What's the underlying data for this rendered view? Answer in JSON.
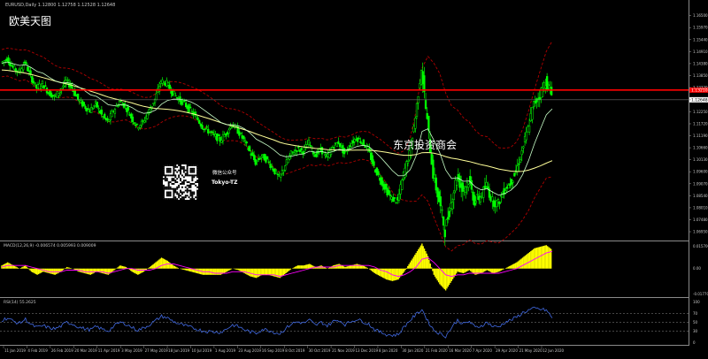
{
  "window": {
    "header": "EURUSD,Daily  1.12800 1.12758 1.12528 1.12648",
    "watermark_main": "欧美天图",
    "watermark_center": "东京投资商会",
    "promo_line1": "微信公众号",
    "promo_line2": "Tokyo-TZ"
  },
  "macd": {
    "header": "MACD(12,26,9) -0.006574 0.005993 0.009009",
    "y_ticks": [
      "0.015700",
      "0.00",
      "-0.017700"
    ]
  },
  "rsi": {
    "header": "RSI(14) 55.2625",
    "y_ticks": [
      "100",
      "70",
      "50",
      "30",
      "0"
    ]
  },
  "x_ticks": [
    "11 Jan 2019",
    "4 Feb 2019",
    "26 Feb 2019",
    "20 Mar 2019",
    "11 Apr 2019",
    "3 May 2019",
    "27 May 2019",
    "18 Jun 2019",
    "10 Jul 2019",
    "1 Aug 2019",
    "23 Aug 2019",
    "16 Sep 2019",
    "8 Oct 2019",
    "30 Oct 2019",
    "21 Nov 2019",
    "13 Dec 2019",
    "8 Jan 2020",
    "30 Jan 2020",
    "21 Feb 2020",
    "16 Mar 2020",
    "7 Apr 2020",
    "29 Apr 2020",
    "21 May 2020",
    "12 Jun 2020"
  ],
  "colors": {
    "candle": "#00ff00",
    "ma_slow": "#ffff99",
    "ma_fast": "#c8ffc8",
    "band": "#b00000",
    "hline": "#ff0000",
    "macd_hist": "#ffff00",
    "macd_signal": "#ff00ff",
    "rsi_line": "#4169e1"
  },
  "chart_data": {
    "type": "line",
    "symbol": "EURUSD",
    "timeframe": "Daily",
    "y_ticks": [
      "1.16500",
      "1.15970",
      "1.15440",
      "1.14910",
      "1.14380",
      "1.13850",
      "1.13320",
      "1.12780",
      "1.12250",
      "1.11720",
      "1.11190",
      "1.10660",
      "1.10130",
      "1.09600",
      "1.09070",
      "1.08540",
      "1.08010",
      "1.07480",
      "1.06950"
    ],
    "ylim": [
      1.066,
      1.168
    ],
    "price_label": "1.12648",
    "hline_label": "1.13210",
    "hline_value": 1.1321,
    "price": [
      1.144,
      1.146,
      1.142,
      1.14,
      1.1445,
      1.138,
      1.133,
      1.135,
      1.131,
      1.129,
      1.132,
      1.136,
      1.133,
      1.128,
      1.125,
      1.123,
      1.126,
      1.121,
      1.118,
      1.123,
      1.127,
      1.125,
      1.12,
      1.116,
      1.118,
      1.123,
      1.128,
      1.136,
      1.135,
      1.131,
      1.128,
      1.126,
      1.123,
      1.12,
      1.116,
      1.114,
      1.112,
      1.11,
      1.113,
      1.117,
      1.114,
      1.11,
      1.105,
      1.1,
      1.103,
      1.101,
      1.097,
      1.093,
      1.099,
      1.104,
      1.106,
      1.105,
      1.109,
      1.103,
      1.106,
      1.102,
      1.107,
      1.109,
      1.104,
      1.108,
      1.111,
      1.109,
      1.106,
      1.098,
      1.093,
      1.088,
      1.084,
      1.083,
      1.095,
      1.104,
      1.12,
      1.142,
      1.118,
      1.095,
      1.083,
      1.07,
      1.082,
      1.094,
      1.088,
      1.092,
      1.083,
      1.085,
      1.09,
      1.083,
      1.082,
      1.088,
      1.091,
      1.096,
      1.105,
      1.115,
      1.126,
      1.13,
      1.136,
      1.13
    ],
    "ma_slow": [
      1.141,
      1.1408,
      1.1404,
      1.14,
      1.1396,
      1.139,
      1.1383,
      1.1376,
      1.1369,
      1.1361,
      1.1354,
      1.1348,
      1.1341,
      1.1333,
      1.1325,
      1.1316,
      1.1308,
      1.1299,
      1.129,
      1.1283,
      1.1277,
      1.1271,
      1.1264,
      1.1256,
      1.1249,
      1.1244,
      1.124,
      1.1238,
      1.1236,
      1.1233,
      1.1229,
      1.1224,
      1.1218,
      1.1211,
      1.1203,
      1.1195,
      1.1186,
      1.1177,
      1.1169,
      1.1162,
      1.1154,
      1.1146,
      1.1137,
      1.1127,
      1.1118,
      1.1109,
      1.11,
      1.109,
      1.1083,
      1.1078,
      1.1074,
      1.107,
      1.1067,
      1.1063,
      1.1061,
      1.1058,
      1.1057,
      1.1056,
      1.1055,
      1.1055,
      1.1056,
      1.1056,
      1.1055,
      1.1053,
      1.105,
      1.1046,
      1.1041,
      1.1036,
      1.1033,
      1.1033,
      1.1036,
      1.1044,
      1.1045,
      1.1042,
      1.1036,
      1.1027,
      1.102,
      1.1016,
      1.101,
      1.1005,
      1.0998,
      1.0991,
      1.0986,
      1.0979,
      1.0972,
      1.0967,
      1.0963,
      1.0961,
      1.0962,
      1.0967,
      1.0976,
      1.0986,
      1.0998,
      1.1009
    ],
    "ma_fast": [
      1.144,
      1.1445,
      1.1437,
      1.143,
      1.1433,
      1.142,
      1.1403,
      1.1395,
      1.1378,
      1.1362,
      1.1353,
      1.1354,
      1.1349,
      1.1335,
      1.1318,
      1.13,
      1.1293,
      1.1276,
      1.1256,
      1.1252,
      1.1256,
      1.1255,
      1.1244,
      1.1227,
      1.1218,
      1.1221,
      1.1233,
      1.1259,
      1.1275,
      1.1281,
      1.1281,
      1.1277,
      1.1268,
      1.1255,
      1.1236,
      1.1217,
      1.1198,
      1.1178,
      1.1168,
      1.1168,
      1.1163,
      1.115,
      1.113,
      1.1104,
      1.109,
      1.1075,
      1.1056,
      1.1034,
      1.1026,
      1.1029,
      1.1035,
      1.1039,
      1.1051,
      1.1046,
      1.105,
      1.1043,
      1.105,
      1.1059,
      1.1055,
      1.1061,
      1.1072,
      1.1077,
      1.1072,
      1.1049,
      1.1024,
      1.0995,
      1.0965,
      1.0942,
      1.0943,
      1.0969,
      1.103,
      1.1138,
      1.115,
      1.11,
      1.1044,
      1.0968,
      1.093,
      1.0933,
      1.0918,
      1.0919,
      1.0893,
      1.088,
      1.0885,
      1.0869,
      1.0856,
      1.0864,
      1.0878,
      1.0903,
      1.0948,
      1.1009,
      1.1084,
      1.1149,
      1.1212,
      1.1238
    ],
    "band_width": [
      0.006,
      0.0062,
      0.0065,
      0.0068,
      0.0066,
      0.007,
      0.0074,
      0.0072,
      0.007,
      0.0068,
      0.0066,
      0.0064,
      0.0063,
      0.0066,
      0.007,
      0.0072,
      0.007,
      0.0072,
      0.0075,
      0.0072,
      0.007,
      0.0066,
      0.0068,
      0.0072,
      0.007,
      0.0068,
      0.0072,
      0.008,
      0.0082,
      0.0078,
      0.0074,
      0.007,
      0.0068,
      0.007,
      0.0074,
      0.0076,
      0.0076,
      0.0075,
      0.0072,
      0.007,
      0.0068,
      0.007,
      0.0074,
      0.0078,
      0.0076,
      0.0074,
      0.0076,
      0.008,
      0.0076,
      0.007,
      0.0066,
      0.0062,
      0.006,
      0.006,
      0.0058,
      0.0058,
      0.0058,
      0.0058,
      0.0058,
      0.006,
      0.0062,
      0.0062,
      0.0064,
      0.007,
      0.0078,
      0.0086,
      0.0094,
      0.01,
      0.011,
      0.014,
      0.02,
      0.028,
      0.032,
      0.034,
      0.035,
      0.034,
      0.032,
      0.03,
      0.028,
      0.026,
      0.025,
      0.024,
      0.023,
      0.022,
      0.021,
      0.02,
      0.019,
      0.019,
      0.02,
      0.022,
      0.024,
      0.026,
      0.028,
      0.03
    ],
    "macd_hist": [
      0.002,
      0.004,
      0.002,
      0.0,
      0.002,
      -0.002,
      -0.004,
      -0.002,
      -0.003,
      -0.004,
      -0.002,
      0.001,
      0.0,
      -0.002,
      -0.003,
      -0.004,
      -0.002,
      -0.003,
      -0.004,
      -0.001,
      0.002,
      0.001,
      -0.002,
      -0.004,
      -0.002,
      0.001,
      0.004,
      0.007,
      0.005,
      0.002,
      0.0,
      -0.001,
      -0.002,
      -0.003,
      -0.004,
      -0.004,
      -0.004,
      -0.004,
      -0.002,
      0.0,
      -0.001,
      -0.003,
      -0.005,
      -0.006,
      -0.004,
      -0.004,
      -0.005,
      -0.006,
      -0.003,
      0.0,
      0.002,
      0.002,
      0.003,
      0.001,
      0.002,
      0.0,
      0.002,
      0.003,
      0.001,
      0.002,
      0.003,
      0.002,
      0.0,
      -0.003,
      -0.005,
      -0.007,
      -0.008,
      -0.007,
      -0.002,
      0.004,
      0.01,
      0.016,
      0.008,
      -0.004,
      -0.01,
      -0.014,
      -0.008,
      -0.002,
      -0.003,
      -0.001,
      -0.004,
      -0.003,
      -0.001,
      -0.003,
      -0.002,
      0.0,
      0.002,
      0.004,
      0.007,
      0.01,
      0.013,
      0.014,
      0.015,
      0.012
    ],
    "macd_signal": [
      0.001,
      0.002,
      0.002,
      0.002,
      0.002,
      0.001,
      0.0,
      -0.001,
      -0.002,
      -0.002,
      -0.002,
      -0.001,
      -0.001,
      -0.001,
      -0.002,
      -0.002,
      -0.002,
      -0.002,
      -0.003,
      -0.002,
      -0.001,
      0.0,
      0.0,
      -0.001,
      -0.001,
      -0.001,
      0.0,
      0.002,
      0.003,
      0.003,
      0.002,
      0.001,
      0.0,
      -0.001,
      -0.002,
      -0.002,
      -0.003,
      -0.003,
      -0.003,
      -0.002,
      -0.002,
      -0.002,
      -0.003,
      -0.004,
      -0.004,
      -0.004,
      -0.004,
      -0.005,
      -0.004,
      -0.003,
      -0.002,
      -0.001,
      0.0,
      0.001,
      0.001,
      0.001,
      0.001,
      0.002,
      0.002,
      0.002,
      0.002,
      0.002,
      0.002,
      0.001,
      -0.001,
      -0.002,
      -0.004,
      -0.005,
      -0.004,
      -0.002,
      0.001,
      0.006,
      0.007,
      0.004,
      0.0,
      -0.004,
      -0.005,
      -0.004,
      -0.004,
      -0.003,
      -0.003,
      -0.003,
      -0.003,
      -0.003,
      -0.003,
      -0.002,
      -0.001,
      0.0,
      0.002,
      0.004,
      0.006,
      0.008,
      0.01,
      0.011
    ],
    "rsi": [
      55,
      60,
      52,
      48,
      57,
      44,
      38,
      42,
      37,
      35,
      41,
      50,
      46,
      39,
      35,
      33,
      40,
      34,
      30,
      42,
      50,
      46,
      38,
      32,
      37,
      45,
      54,
      64,
      60,
      52,
      46,
      42,
      38,
      34,
      30,
      29,
      28,
      27,
      35,
      44,
      40,
      33,
      28,
      25,
      34,
      32,
      27,
      24,
      36,
      47,
      51,
      48,
      55,
      43,
      50,
      42,
      52,
      55,
      45,
      52,
      57,
      52,
      46,
      33,
      27,
      22,
      20,
      22,
      40,
      55,
      68,
      80,
      52,
      32,
      24,
      18,
      38,
      55,
      46,
      52,
      38,
      42,
      50,
      40,
      40,
      50,
      55,
      62,
      72,
      78,
      82,
      80,
      78,
      60
    ],
    "rsi_levels": [
      70,
      50,
      30
    ],
    "macd_ylim": [
      -0.0177,
      0.0157
    ],
    "rsi_ylim": [
      0,
      100
    ]
  }
}
